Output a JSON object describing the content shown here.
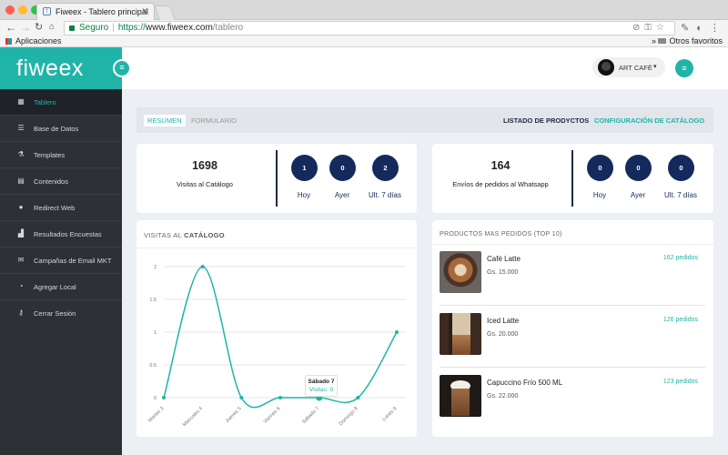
{
  "browser": {
    "tab_title": "Fiweex - Tablero principal",
    "secure_label": "Seguro",
    "url_scheme": "https://",
    "url_host": "www.fiweex.com",
    "url_path": "/tablero",
    "bookmark_apps": "Aplicaciones",
    "bookmark_other": "Otros favoritos"
  },
  "brand": {
    "logo_text": "fiweex",
    "accent": "#20b4a9",
    "navy": "#142a5c",
    "sidebar_bg": "#2d3035"
  },
  "sidebar": {
    "items": [
      {
        "label": "Tablero",
        "icon": "dashboard-icon"
      },
      {
        "label": "Base de Datos",
        "icon": "database-icon"
      },
      {
        "label": "Templates",
        "icon": "flask-icon"
      },
      {
        "label": "Contenidos",
        "icon": "archive-icon"
      },
      {
        "label": "Redirect Web",
        "icon": "globe-icon"
      },
      {
        "label": "Resultados Encuestas",
        "icon": "bar-chart-icon"
      },
      {
        "label": "Campañas de Email MKT",
        "icon": "envelope-icon"
      },
      {
        "label": "Agregar Local",
        "icon": "wifi-icon"
      },
      {
        "label": "Cerrar Sesión",
        "icon": "key-icon"
      }
    ]
  },
  "header": {
    "user_name": "ART CAFÉ"
  },
  "tabs": {
    "resumen": "RESUMEN",
    "formulario": "FORMULARIO",
    "listado": "LISTADO DE PRODYCTOS",
    "config": "CONFIGURACIÓN DE CATÁLOGO"
  },
  "stats": {
    "visits": {
      "total": "1698",
      "label": "Visitas al Catálogo",
      "hoy": "1",
      "ayer": "0",
      "ult": "2"
    },
    "orders": {
      "total": "164",
      "label": "Envíos de pedidos al Whatsapp",
      "hoy": "0",
      "ayer": "0",
      "ult": "0"
    },
    "labels": {
      "hoy": "Hoy",
      "ayer": "Ayer",
      "ult": "Ult. 7 días"
    }
  },
  "chart_panel": {
    "title_plain": "VISITAS AL ",
    "title_bold": "CATÁLOGO"
  },
  "chart_data": {
    "type": "line",
    "categories": [
      "Martes 3",
      "Miercoles 4",
      "Jueves 5",
      "Viernes 6",
      "Sábado 7",
      "Domingo 8",
      "Lunes 9"
    ],
    "values": [
      0,
      2,
      0,
      0,
      0,
      0,
      1
    ],
    "yticks": [
      "0",
      "0.5",
      "1",
      "1.5",
      "2"
    ],
    "ylim": [
      0,
      2
    ],
    "grid": true,
    "color": "#20b4a9",
    "tooltip": {
      "title": "Sábado 7",
      "text": "Visitas: 0"
    }
  },
  "products": {
    "title": "PRODUCTOS MAS PEDIDOS (TOP 10)",
    "items": [
      {
        "name": "Café Latte",
        "price": "Gs. 15.000",
        "count": "162 pedidos",
        "icon": "latte-art-photo"
      },
      {
        "name": "Iced Latte",
        "price": "Gs. 20.000",
        "count": "126 pedidos",
        "icon": "iced-latte-photo"
      },
      {
        "name": "Capuccino Frío 500 ML",
        "price": "Gs. 22.000",
        "count": "123 pedidos",
        "icon": "frappe-photo"
      }
    ]
  }
}
